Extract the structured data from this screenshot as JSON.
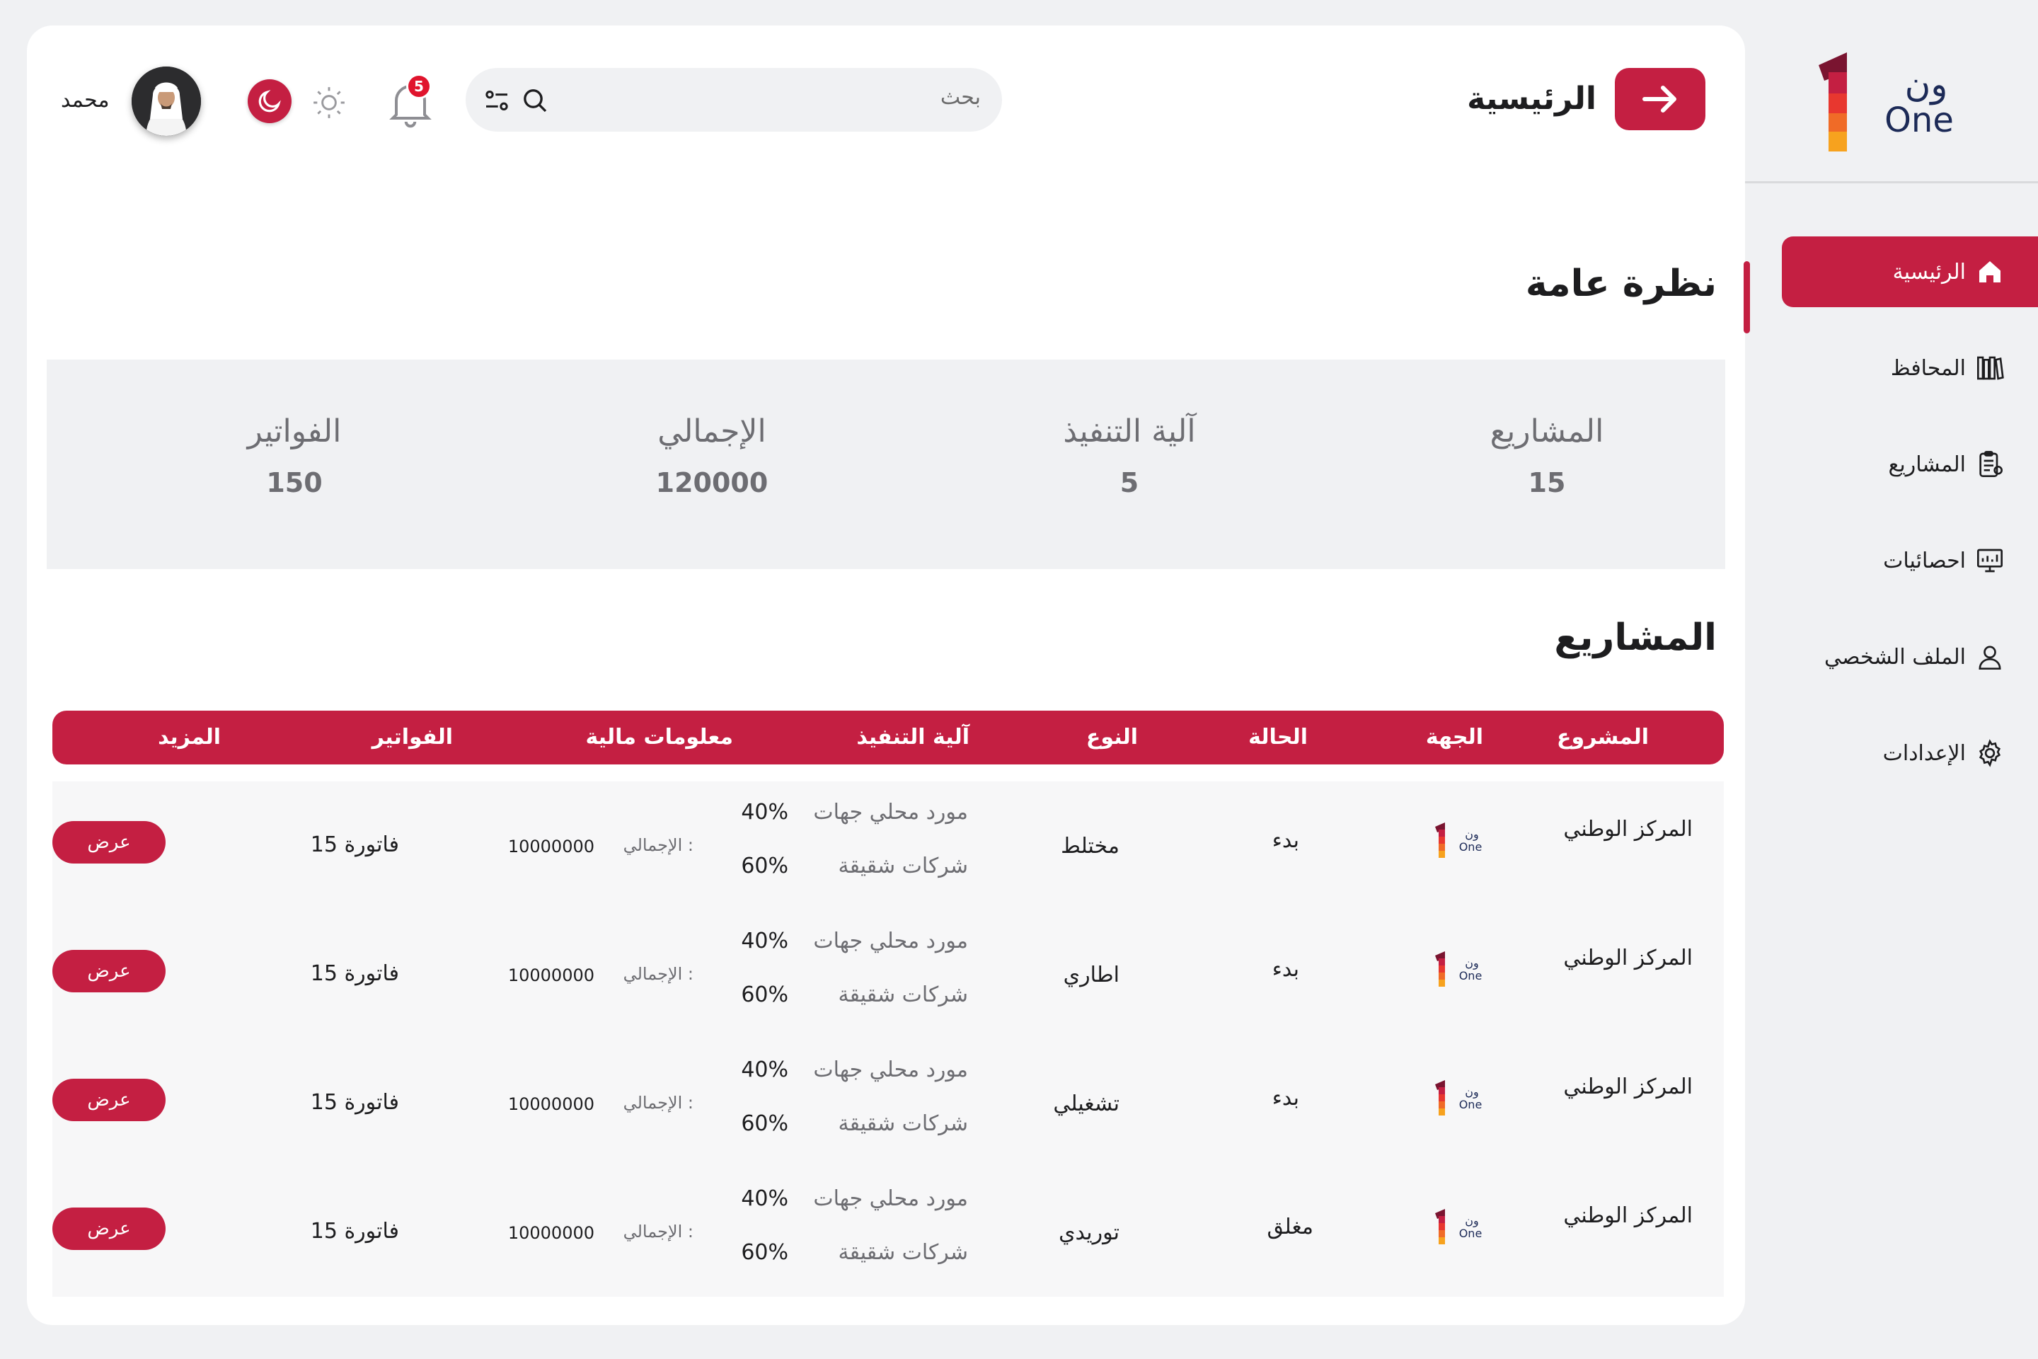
{
  "sidebar": {
    "logo": {
      "arabic": "ون",
      "latin": "One"
    },
    "items": [
      {
        "label": "الرئيسية",
        "icon": "home-icon",
        "active": true
      },
      {
        "label": "المحافظ",
        "icon": "books-icon",
        "active": false
      },
      {
        "label": "المشاريع",
        "icon": "clipboard-icon",
        "active": false
      },
      {
        "label": "احصائيات",
        "icon": "monitor-chart-icon",
        "active": false
      },
      {
        "label": "الملف الشخصي",
        "icon": "user-icon",
        "active": false
      },
      {
        "label": "الإعدادات",
        "icon": "gear-icon",
        "active": false
      }
    ]
  },
  "header": {
    "title": "الرئيسية",
    "search_placeholder": "بحث",
    "notifications_count": "5",
    "user_name": "محمد"
  },
  "overview": {
    "title": "نظرة عامة",
    "stats": [
      {
        "label": "المشاريع",
        "value": "15"
      },
      {
        "label": "آلية التنفيذ",
        "value": "5"
      },
      {
        "label": "الإجمالي",
        "value": "120000"
      },
      {
        "label": "الفواتير",
        "value": "150"
      }
    ]
  },
  "projects": {
    "title": "المشاريع",
    "columns": [
      "المشروع",
      "الجهة",
      "الحالة",
      "النوع",
      "آلية التنفيذ",
      "معلومات مالية",
      "الفواتير",
      "المزيد"
    ],
    "rows": [
      {
        "project": "المركز الوطني",
        "status": "بدء",
        "type": "مختلط",
        "mech1": "مورد محلي جهات",
        "pct1": "40%",
        "mech2": "شركات شقيقة",
        "pct2": "60%",
        "fin_label": "الإجمالي :",
        "fin_value": "10000000",
        "invoices": "15 فاتورة",
        "action": "عرض"
      },
      {
        "project": "المركز الوطني",
        "status": "بدء",
        "type": "اطاري",
        "mech1": "مورد محلي جهات",
        "pct1": "40%",
        "mech2": "شركات شقيقة",
        "pct2": "60%",
        "fin_label": "الإجمالي :",
        "fin_value": "10000000",
        "invoices": "15 فاتورة",
        "action": "عرض"
      },
      {
        "project": "المركز الوطني",
        "status": "بدء",
        "type": "تشغيلي",
        "mech1": "مورد محلي جهات",
        "pct1": "40%",
        "mech2": "شركات شقيقة",
        "pct2": "60%",
        "fin_label": "الإجمالي :",
        "fin_value": "10000000",
        "invoices": "15 فاتورة",
        "action": "عرض"
      },
      {
        "project": "المركز الوطني",
        "status": "مغلق",
        "type": "توريدي",
        "mech1": "مورد محلي جهات",
        "pct1": "40%",
        "mech2": "شركات شقيقة",
        "pct2": "60%",
        "fin_label": "الإجمالي :",
        "fin_value": "10000000",
        "invoices": "15 فاتورة",
        "action": "عرض"
      }
    ]
  },
  "colors": {
    "accent": "#c41f42",
    "background": "#f0f1f3",
    "badge": "#e0142d"
  }
}
